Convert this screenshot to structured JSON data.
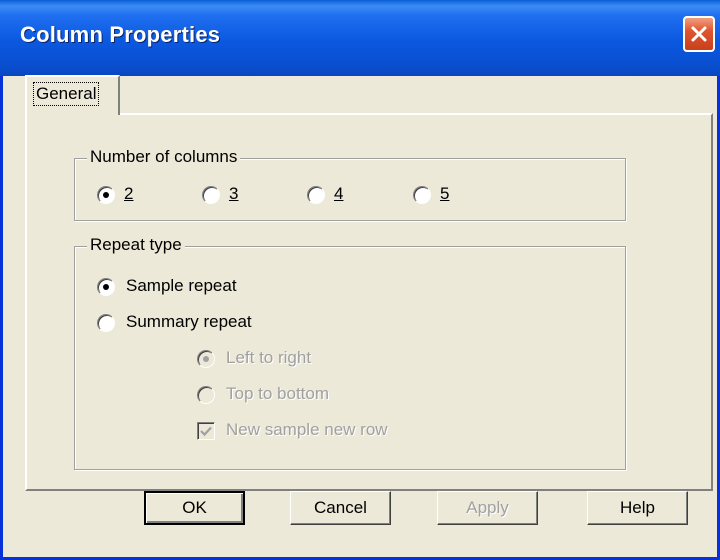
{
  "window": {
    "title": "Column Properties"
  },
  "tabs": [
    {
      "label": "General",
      "selected": true
    }
  ],
  "columns_group": {
    "title": "Number of columns",
    "options": [
      {
        "label": "2",
        "checked": true
      },
      {
        "label": "3",
        "checked": false
      },
      {
        "label": "4",
        "checked": false
      },
      {
        "label": "5",
        "checked": false
      }
    ]
  },
  "repeat_group": {
    "title": "Repeat type",
    "sample_repeat": {
      "label": "Sample repeat",
      "checked": true
    },
    "summary_repeat": {
      "label": "Summary repeat",
      "checked": false
    },
    "left_to_right": {
      "label": "Left to right",
      "checked": true,
      "enabled": false
    },
    "top_to_bottom": {
      "label": "Top to bottom",
      "checked": false,
      "enabled": false
    },
    "new_sample_new_row": {
      "label": "New sample new row",
      "checked": true,
      "enabled": false
    }
  },
  "buttons": {
    "ok": "OK",
    "cancel": "Cancel",
    "apply": "Apply",
    "help": "Help"
  },
  "colors": {
    "titlebar": "#0b58e0",
    "close_button": "#e0552e",
    "face": "#ece9d8",
    "disabled_text": "#a0a0a0"
  }
}
